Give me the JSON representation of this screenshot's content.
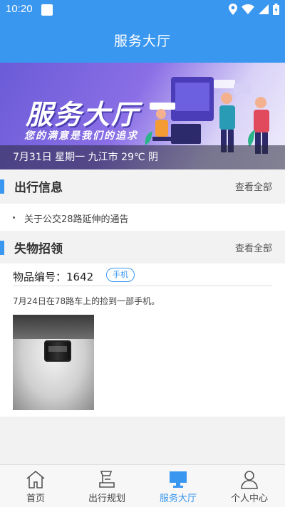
{
  "status_bar": {
    "time": "10:20"
  },
  "app_bar": {
    "title": "服务大厅"
  },
  "banner": {
    "headline": "服务大厅",
    "slogan": "您的满意是我们的追求",
    "info": "7月31日 星期一 九江市 29℃ 阴"
  },
  "travel_info": {
    "title": "出行信息",
    "more": "查看全部",
    "items": [
      "关于公交28路延伸的通告"
    ]
  },
  "lost_found": {
    "title": "失物招领",
    "more": "查看全部",
    "item_id": "物品编号：1642",
    "tag": "手机",
    "description": "7月24日在78路车上的捡到一部手机。"
  },
  "tabs": [
    {
      "label": "首页",
      "icon": "home-icon"
    },
    {
      "label": "出行规划",
      "icon": "route-plan-icon"
    },
    {
      "label": "服务大厅",
      "icon": "monitor-icon",
      "active": true
    },
    {
      "label": "个人中心",
      "icon": "user-icon"
    }
  ],
  "colors": {
    "primary": "#3a97f0",
    "background": "#f2f2f2"
  }
}
